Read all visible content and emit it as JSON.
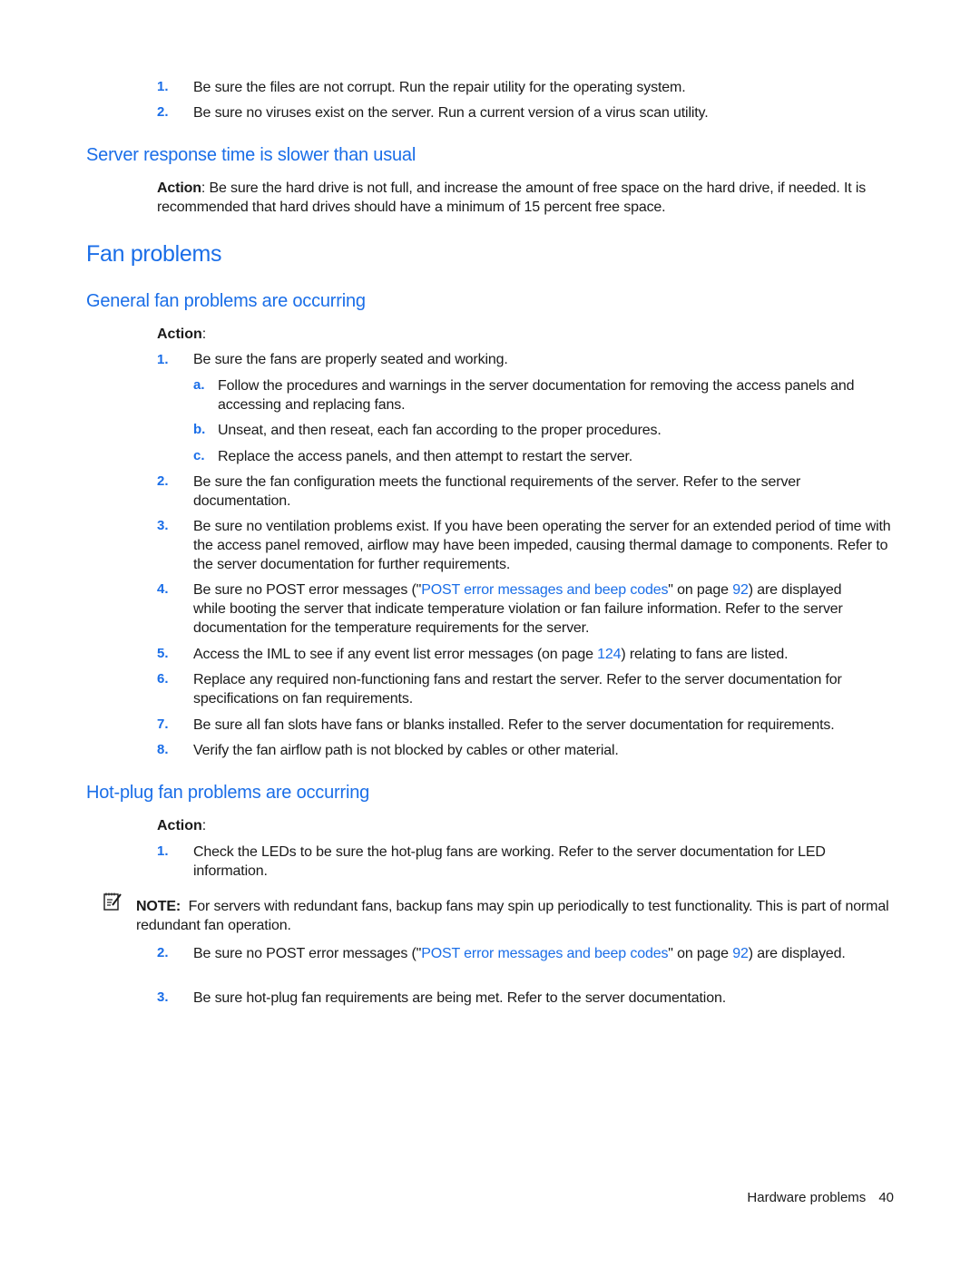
{
  "intro_list": [
    {
      "num": "1.",
      "text": "Be sure the files are not corrupt. Run the repair utility for the operating system."
    },
    {
      "num": "2.",
      "text": "Be sure no viruses exist on the server. Run a current version of a virus scan utility."
    }
  ],
  "server_response": {
    "heading": "Server response time is slower than usual",
    "action_label": "Action",
    "action_text": ": Be sure the hard drive is not full, and increase the amount of free space on the hard drive, if needed. It is recommended that hard drives should have a minimum of 15 percent free space."
  },
  "fan_problems": {
    "heading": "Fan problems"
  },
  "general_fan": {
    "heading": "General fan problems are occurring",
    "action_label": "Action",
    "action_colon": ":",
    "steps": [
      {
        "num": "1.",
        "text": "Be sure the fans are properly seated and working."
      },
      {
        "num": "2.",
        "text": "Be sure the fan configuration meets the functional requirements of the server. Refer to the server documentation."
      },
      {
        "num": "3.",
        "text": "Be sure no ventilation problems exist. If you have been operating the server for an extended period of time with the access panel removed, airflow may have been impeded, causing thermal damage to components. Refer to the server documentation for further requirements."
      },
      {
        "num": "4.",
        "text_before": "Be sure no POST error messages (\"",
        "link": "POST error messages and beep codes",
        "text_mid": "\" on page ",
        "page": "92",
        "text_after": ") are displayed while booting the server that indicate temperature violation or fan failure information. Refer to the server documentation for the temperature requirements for the server."
      },
      {
        "num": "5.",
        "text_before": "Access the IML to see if any event list error messages (on page ",
        "page": "124",
        "text_after": ") relating to fans are listed."
      },
      {
        "num": "6.",
        "text": "Replace any required non-functioning fans and restart the server. Refer to the server documentation for specifications on fan requirements."
      },
      {
        "num": "7.",
        "text": "Be sure all fan slots have fans or blanks installed. Refer to the server documentation for requirements."
      },
      {
        "num": "8.",
        "text": "Verify the fan airflow path is not blocked by cables or other material."
      }
    ],
    "substeps": [
      {
        "letter": "a.",
        "text": "Follow the procedures and warnings in the server documentation for removing the access panels and accessing and replacing fans."
      },
      {
        "letter": "b.",
        "text": "Unseat, and then reseat, each fan according to the proper procedures."
      },
      {
        "letter": "c.",
        "text": "Replace the access panels, and then attempt to restart the server."
      }
    ]
  },
  "hotplug_fan": {
    "heading": "Hot-plug fan problems are occurring",
    "action_label": "Action",
    "action_colon": ":",
    "steps": [
      {
        "num": "1.",
        "text": "Check the LEDs to be sure the hot-plug fans are working. Refer to the server documentation for LED information."
      },
      {
        "num": "2.",
        "text_before": "Be sure no POST error messages (\"",
        "link": "POST error messages and beep codes",
        "text_mid": "\" on page ",
        "page": "92",
        "text_after": ") are displayed."
      },
      {
        "num": "3.",
        "text": "Be sure hot-plug fan requirements are being met. Refer to the server documentation."
      }
    ],
    "note": {
      "icon": "note-icon",
      "label": "NOTE:",
      "text": "For servers with redundant fans, backup fans may spin up periodically to test functionality. This is part of normal redundant fan operation."
    }
  },
  "footer": {
    "section": "Hardware problems",
    "page_number": "40"
  },
  "colors": {
    "accent": "#1a6ee8",
    "text": "#1a1a1a"
  }
}
